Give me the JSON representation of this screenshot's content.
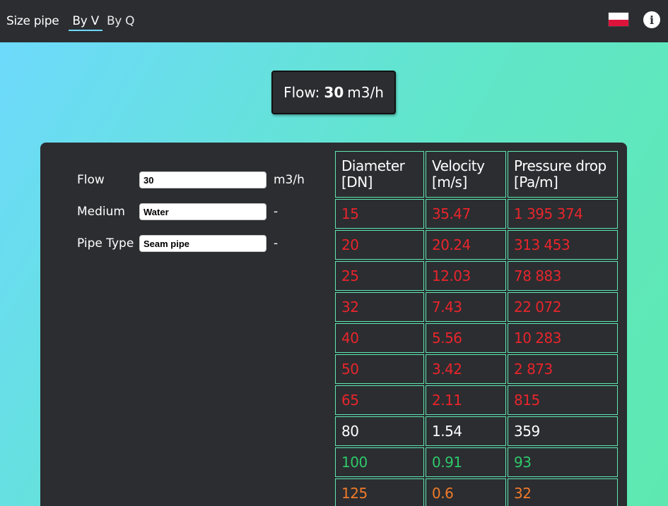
{
  "header": {
    "title": "Size pipe",
    "tabs": [
      {
        "label": "By V",
        "active": true
      },
      {
        "label": "By Q",
        "active": false
      }
    ],
    "flag_icon": "poland-flag-icon",
    "info_icon": "info-icon",
    "info_glyph": "i"
  },
  "badge": {
    "prefix": "Flow:",
    "value": "30",
    "unit": "m3/h"
  },
  "form": {
    "flow": {
      "label": "Flow",
      "value": "30",
      "unit": "m3/h"
    },
    "medium": {
      "label": "Medium",
      "value": "Water",
      "unit": "-"
    },
    "pipe_type": {
      "label": "Pipe Type",
      "value": "Seam pipe",
      "unit": "-"
    }
  },
  "table": {
    "columns": [
      {
        "line1": "Diameter",
        "line2": "[DN]"
      },
      {
        "line1": "Velocity",
        "line2": "[m/s]"
      },
      {
        "line1": "Pressure drop",
        "line2": "[Pa/m]"
      }
    ],
    "rows": [
      {
        "dn": "15",
        "velocity": "35.47",
        "pressure": "1 395 374",
        "status": "high"
      },
      {
        "dn": "20",
        "velocity": "20.24",
        "pressure": "313 453",
        "status": "high"
      },
      {
        "dn": "25",
        "velocity": "12.03",
        "pressure": "78 883",
        "status": "high"
      },
      {
        "dn": "32",
        "velocity": "7.43",
        "pressure": "22 072",
        "status": "high"
      },
      {
        "dn": "40",
        "velocity": "5.56",
        "pressure": "10 283",
        "status": "high"
      },
      {
        "dn": "50",
        "velocity": "3.42",
        "pressure": "2 873",
        "status": "high"
      },
      {
        "dn": "65",
        "velocity": "2.11",
        "pressure": "815",
        "status": "high"
      },
      {
        "dn": "80",
        "velocity": "1.54",
        "pressure": "359",
        "status": "neutral"
      },
      {
        "dn": "100",
        "velocity": "0.91",
        "pressure": "93",
        "status": "optimal"
      },
      {
        "dn": "125",
        "velocity": "0.6",
        "pressure": "32",
        "status": "low"
      }
    ]
  },
  "colors": {
    "high": "#e8252b",
    "neutral": "#ffffff",
    "optimal": "#2ec96a",
    "low": "#f07a2a",
    "accent": "#6ed9ff",
    "panel": "#2b2d31",
    "table_border": "#5ee8b0"
  }
}
